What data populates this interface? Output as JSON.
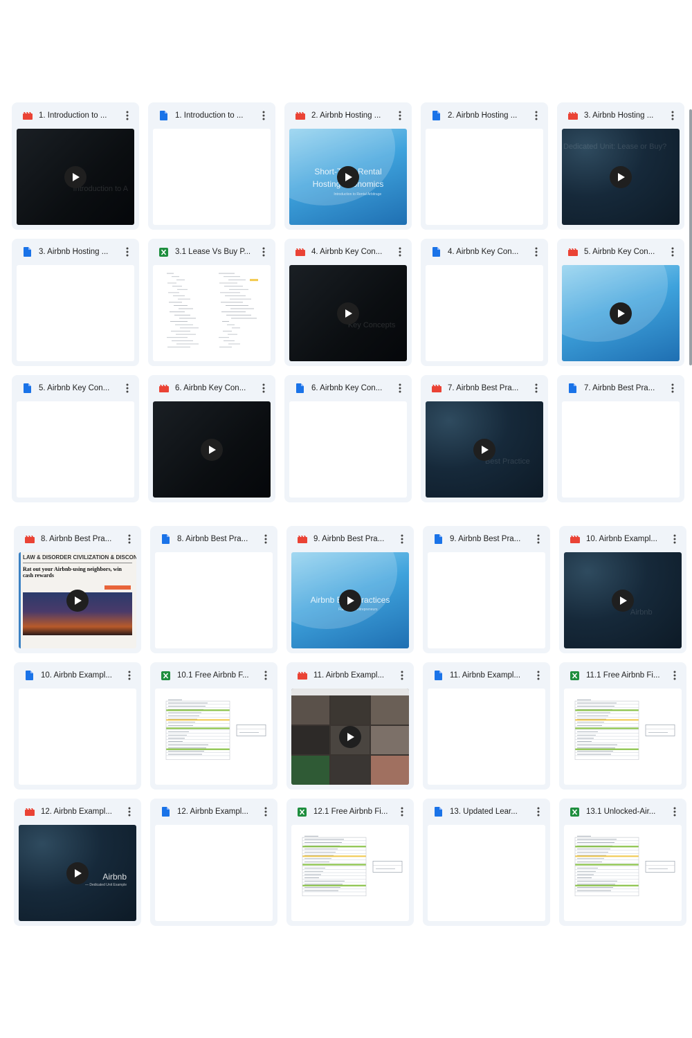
{
  "colors": {
    "card_bg": "#f0f4f9",
    "video_icon": "#ea4335",
    "doc_icon": "#1a73e8",
    "sheet_icon": "#1e8e3e"
  },
  "section_a": [
    {
      "name": "1. Introduction to ...",
      "type": "video",
      "thumb": "dark",
      "faint": "Introduction to A"
    },
    {
      "name": "1. Introduction to ...",
      "type": "doc",
      "thumb": "blank"
    },
    {
      "name": "2. Airbnb Hosting ...",
      "type": "video",
      "thumb": "blue",
      "overlay": "Short-Term Rental",
      "overlay2": "Hosting Economics",
      "subline": "Introduction to Rental Arbitrage"
    },
    {
      "name": "2. Airbnb Hosting ...",
      "type": "doc",
      "thumb": "blank"
    },
    {
      "name": "3. Airbnb Hosting ...",
      "type": "video",
      "thumb": "navy",
      "faint": "Dedicated Unit: Lease or Buy?"
    },
    {
      "name": "3. Airbnb Hosting ...",
      "type": "doc",
      "thumb": "blank"
    },
    {
      "name": "3.1 Lease Vs Buy P...",
      "type": "sheet",
      "thumb": "sheet"
    },
    {
      "name": "4. Airbnb Key Con...",
      "type": "video",
      "thumb": "dark",
      "faint": "Key Concepts"
    },
    {
      "name": "4. Airbnb Key Con...",
      "type": "doc",
      "thumb": "blank"
    },
    {
      "name": "5. Airbnb Key Con...",
      "type": "video",
      "thumb": "blue"
    },
    {
      "name": "5. Airbnb Key Con...",
      "type": "doc",
      "thumb": "blank"
    },
    {
      "name": "6. Airbnb Key Con...",
      "type": "video",
      "thumb": "dark"
    },
    {
      "name": "6. Airbnb Key Con...",
      "type": "doc",
      "thumb": "blank"
    },
    {
      "name": "7. Airbnb Best Pra...",
      "type": "video",
      "thumb": "navy",
      "faint": "Best Practice"
    },
    {
      "name": "7. Airbnb Best Pra...",
      "type": "doc",
      "thumb": "blank"
    }
  ],
  "section_b": [
    {
      "name": "8. Airbnb Best Pra...",
      "type": "video",
      "thumb": "news",
      "headline": "Rat out your Airbnb-using neighbors, win cash rewards",
      "masthead": "LAW & DISORDER   CIVILIZATION & DISCONTENTS"
    },
    {
      "name": "8. Airbnb Best Pra...",
      "type": "doc",
      "thumb": "blank"
    },
    {
      "name": "9. Airbnb Best Pra...",
      "type": "video",
      "thumb": "blue",
      "overlay": "Airbnb Best Practices",
      "subline": "Full Time Rentrepreneurs"
    },
    {
      "name": "9. Airbnb Best Pra...",
      "type": "doc",
      "thumb": "blank"
    },
    {
      "name": "10. Airbnb Exampl...",
      "type": "video",
      "thumb": "navy",
      "faint": "Airbnb"
    },
    {
      "name": "10. Airbnb Exampl...",
      "type": "doc",
      "thumb": "blank"
    },
    {
      "name": "10.1 Free Airbnb F...",
      "type": "sheet",
      "thumb": "sheet"
    },
    {
      "name": "11. Airbnb Exampl...",
      "type": "video",
      "thumb": "photo"
    },
    {
      "name": "11. Airbnb Exampl...",
      "type": "doc",
      "thumb": "blank"
    },
    {
      "name": "11.1 Free Airbnb Fi...",
      "type": "sheet",
      "thumb": "sheet"
    },
    {
      "name": "12. Airbnb Exampl...",
      "type": "video",
      "thumb": "navy",
      "overlay": "Airbnb",
      "subline": "— Dedicated Unit Example"
    },
    {
      "name": "12. Airbnb Exampl...",
      "type": "doc",
      "thumb": "blank"
    },
    {
      "name": "12.1 Free Airbnb Fi...",
      "type": "sheet",
      "thumb": "sheet"
    },
    {
      "name": "13. Updated Lear...",
      "type": "doc",
      "thumb": "blank"
    },
    {
      "name": "13.1 Unlocked-Air...",
      "type": "sheet",
      "thumb": "sheet"
    }
  ]
}
